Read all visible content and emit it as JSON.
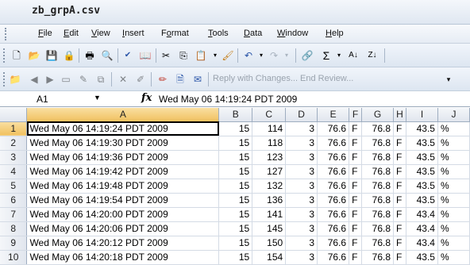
{
  "window": {
    "title": "zb_grpA.csv"
  },
  "menu": [
    "File",
    "Edit",
    "View",
    "Insert",
    "Format",
    "Tools",
    "Data",
    "Window",
    "Help"
  ],
  "toolbar2": {
    "review_text": "Reply with Changes...  End Review..."
  },
  "formula_bar": {
    "name_box": "A1",
    "formula": "Wed May 06 14:19:24 PDT 2009"
  },
  "columns": [
    "A",
    "B",
    "C",
    "D",
    "E",
    "F",
    "G",
    "H",
    "I",
    "J"
  ],
  "rows": [
    {
      "n": "1",
      "c": [
        "Wed May 06 14:19:24 PDT 2009",
        "15",
        "114",
        "3",
        "76.6",
        "F",
        "76.8",
        "F",
        "43.5",
        "%"
      ]
    },
    {
      "n": "2",
      "c": [
        "Wed May 06 14:19:30 PDT 2009",
        "15",
        "118",
        "3",
        "76.6",
        "F",
        "76.8",
        "F",
        "43.5",
        "%"
      ]
    },
    {
      "n": "3",
      "c": [
        "Wed May 06 14:19:36 PDT 2009",
        "15",
        "123",
        "3",
        "76.6",
        "F",
        "76.8",
        "F",
        "43.5",
        "%"
      ]
    },
    {
      "n": "4",
      "c": [
        "Wed May 06 14:19:42 PDT 2009",
        "15",
        "127",
        "3",
        "76.6",
        "F",
        "76.8",
        "F",
        "43.5",
        "%"
      ]
    },
    {
      "n": "5",
      "c": [
        "Wed May 06 14:19:48 PDT 2009",
        "15",
        "132",
        "3",
        "76.6",
        "F",
        "76.8",
        "F",
        "43.5",
        "%"
      ]
    },
    {
      "n": "6",
      "c": [
        "Wed May 06 14:19:54 PDT 2009",
        "15",
        "136",
        "3",
        "76.6",
        "F",
        "76.8",
        "F",
        "43.5",
        "%"
      ]
    },
    {
      "n": "7",
      "c": [
        "Wed May 06 14:20:00 PDT 2009",
        "15",
        "141",
        "3",
        "76.6",
        "F",
        "76.8",
        "F",
        "43.4",
        "%"
      ]
    },
    {
      "n": "8",
      "c": [
        "Wed May 06 14:20:06 PDT 2009",
        "15",
        "145",
        "3",
        "76.6",
        "F",
        "76.8",
        "F",
        "43.4",
        "%"
      ]
    },
    {
      "n": "9",
      "c": [
        "Wed May 06 14:20:12 PDT 2009",
        "15",
        "150",
        "3",
        "76.6",
        "F",
        "76.8",
        "F",
        "43.4",
        "%"
      ]
    },
    {
      "n": "10",
      "c": [
        "Wed May 06 14:20:18 PDT 2009",
        "15",
        "154",
        "3",
        "76.6",
        "F",
        "76.8",
        "F",
        "43.5",
        "%"
      ]
    }
  ]
}
